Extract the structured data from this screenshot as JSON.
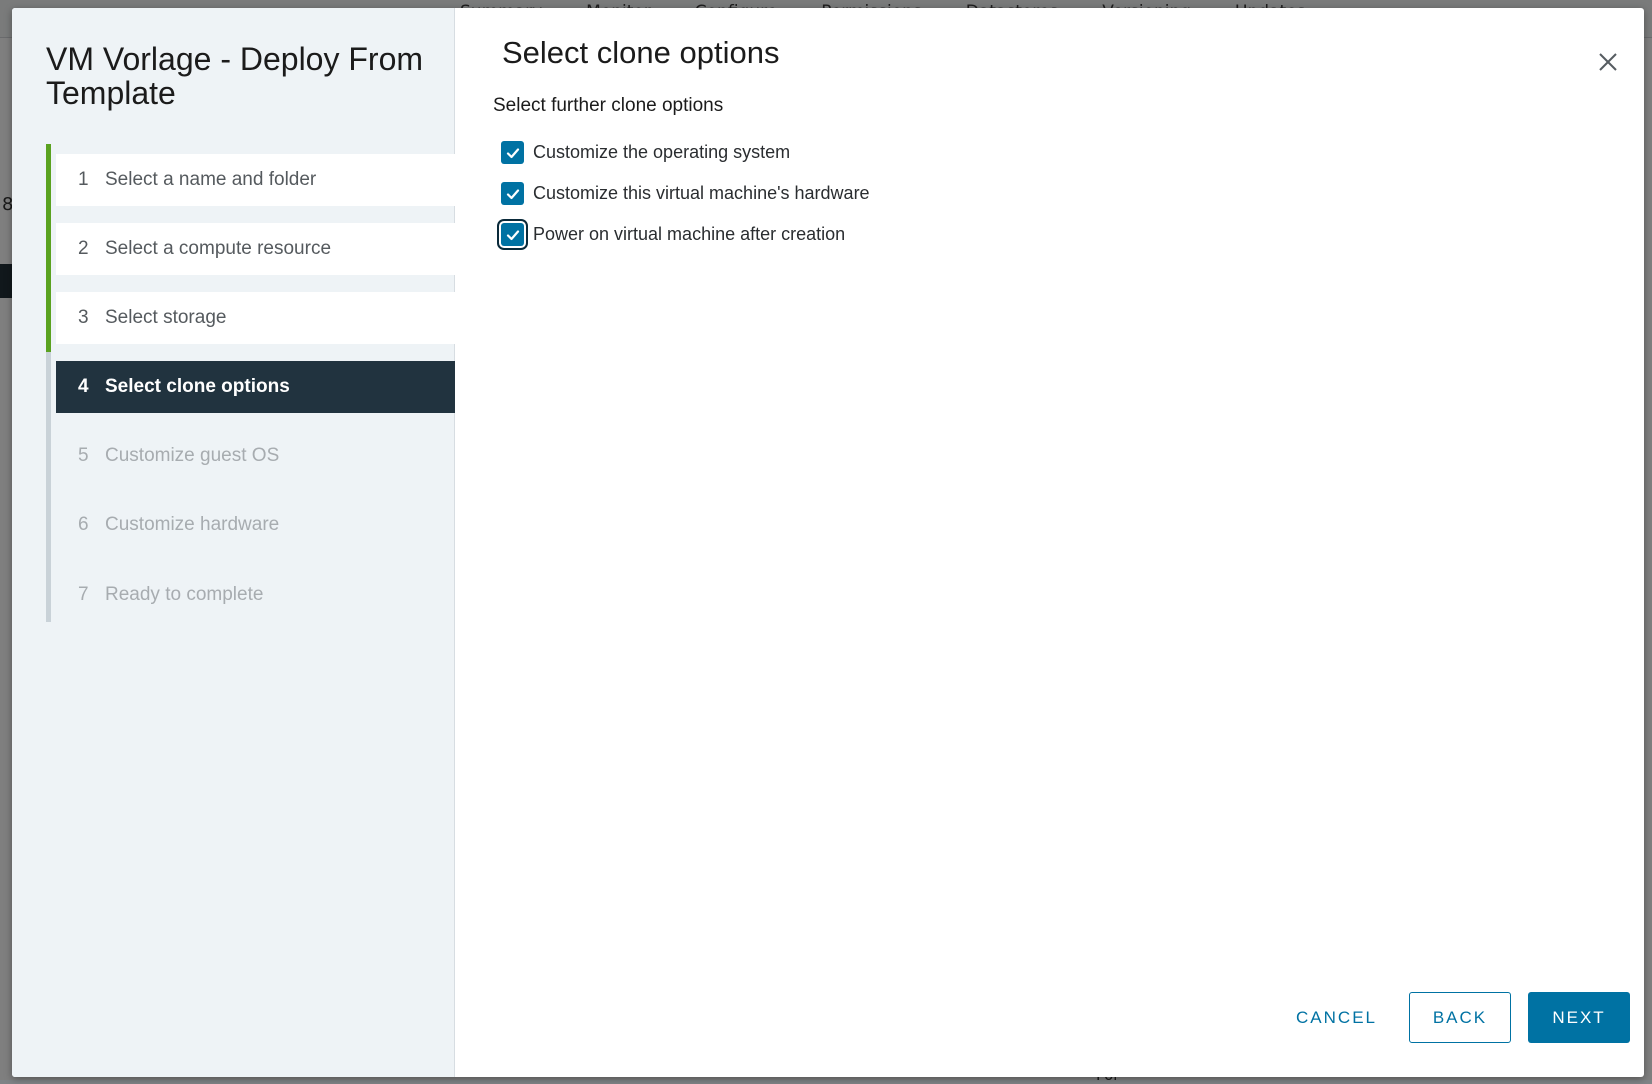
{
  "background": {
    "tabs": [
      "Summary",
      "Monitor",
      "Configure",
      "Permissions",
      "Datastores",
      "Versioning",
      "Updates"
    ],
    "edge_char": "8",
    "bottom_text": "For"
  },
  "wizard": {
    "title": "VM Vorlage - Deploy From Template",
    "steps": [
      {
        "number": "1",
        "label": "Select a name and folder",
        "state": "done"
      },
      {
        "number": "2",
        "label": "Select a compute resource",
        "state": "done"
      },
      {
        "number": "3",
        "label": "Select storage",
        "state": "done"
      },
      {
        "number": "4",
        "label": "Select clone options",
        "state": "active"
      },
      {
        "number": "5",
        "label": "Customize guest OS",
        "state": "pending"
      },
      {
        "number": "6",
        "label": "Customize hardware",
        "state": "pending"
      },
      {
        "number": "7",
        "label": "Ready to complete",
        "state": "pending"
      }
    ]
  },
  "page": {
    "title": "Select clone options",
    "section_label": "Select further clone options",
    "options": [
      {
        "label": "Customize the operating system",
        "checked": true
      },
      {
        "label": "Customize this virtual machine's hardware",
        "checked": true
      },
      {
        "label": "Power on virtual machine after creation",
        "checked": true,
        "focused": true
      }
    ]
  },
  "footer": {
    "cancel_label": "CANCEL",
    "back_label": "BACK",
    "next_label": "NEXT"
  },
  "icons": {
    "close": "close-icon",
    "check": "checkmark-icon"
  },
  "colors": {
    "primary": "#0072a3",
    "step_done_rail": "#5aa220",
    "step_active_bg": "#21333f",
    "sidebar_bg": "#eef3f6"
  }
}
